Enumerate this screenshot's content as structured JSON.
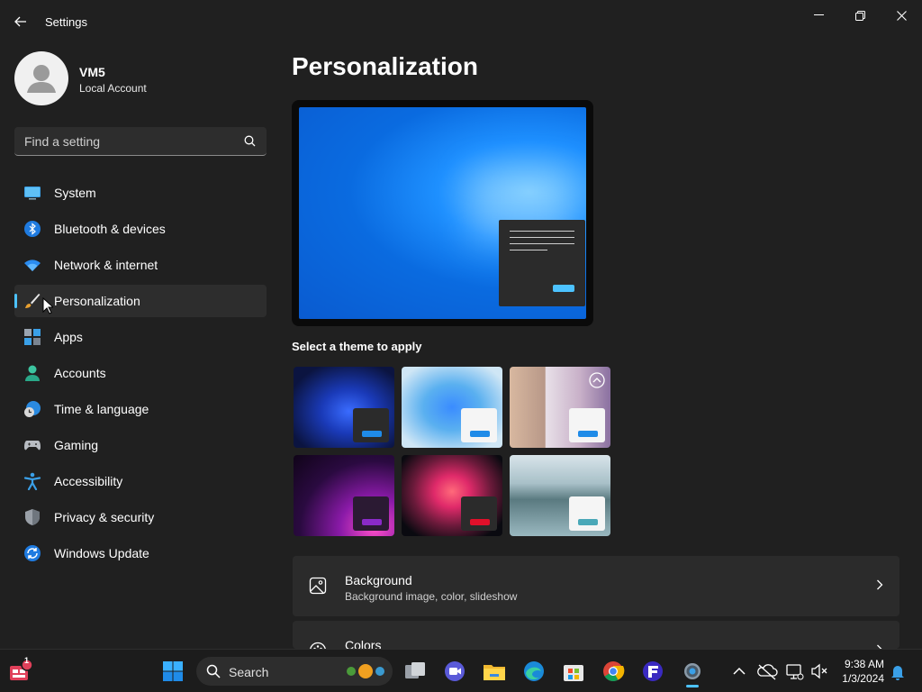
{
  "window": {
    "title": "Settings"
  },
  "user": {
    "name": "VM5",
    "account_type": "Local Account"
  },
  "search": {
    "placeholder": "Find a setting"
  },
  "sidebar": {
    "items": [
      {
        "label": "System",
        "icon": "monitor-icon"
      },
      {
        "label": "Bluetooth & devices",
        "icon": "bluetooth-icon"
      },
      {
        "label": "Network & internet",
        "icon": "wifi-icon"
      },
      {
        "label": "Personalization",
        "icon": "brush-icon",
        "active": true
      },
      {
        "label": "Apps",
        "icon": "apps-icon"
      },
      {
        "label": "Accounts",
        "icon": "person-icon"
      },
      {
        "label": "Time & language",
        "icon": "clock-globe-icon"
      },
      {
        "label": "Gaming",
        "icon": "gamepad-icon"
      },
      {
        "label": "Accessibility",
        "icon": "accessibility-icon"
      },
      {
        "label": "Privacy & security",
        "icon": "shield-icon"
      },
      {
        "label": "Windows Update",
        "icon": "update-icon"
      }
    ]
  },
  "main": {
    "title": "Personalization",
    "themes_label": "Select a theme to apply",
    "cards": [
      {
        "title": "Background",
        "subtitle": "Background image, color, slideshow",
        "icon": "image-icon"
      },
      {
        "title": "Colors",
        "subtitle": "",
        "icon": "palette-icon"
      }
    ]
  },
  "taskbar": {
    "search_label": "Search",
    "notification_badge": "1",
    "time": "9:38 AM",
    "date": "1/3/2024"
  },
  "colors": {
    "accent": "#4cc2ff",
    "background": "#202020",
    "card": "#2b2b2b"
  }
}
